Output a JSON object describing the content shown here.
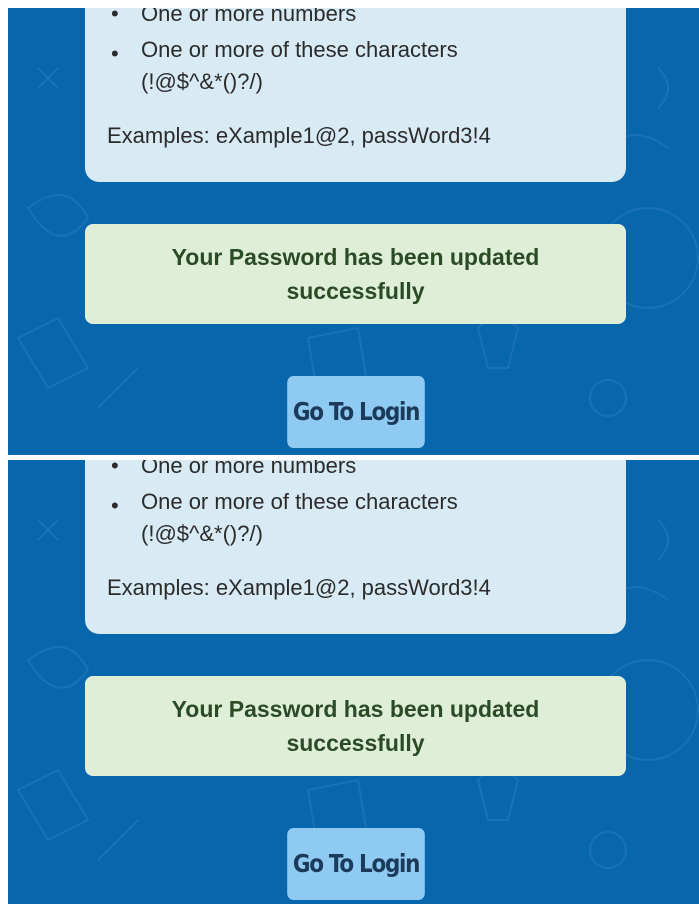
{
  "password_requirements": {
    "cut_off_item": "One or more numbers",
    "special_chars_item_line1": "One or more of these characters",
    "special_chars_item_line2": "(!@$^&*()?/)",
    "examples": "Examples: eXample1@2, passWord3!4"
  },
  "success_message": {
    "line1": "Your Password has been updated",
    "line2": "successfully"
  },
  "login_button": {
    "label": "Go To Login"
  },
  "colors": {
    "background": "#0866ad",
    "requirements_card": "#d8eaf4",
    "success_box": "#dfeed6",
    "success_text": "#2b4b27",
    "button": "#8fcaf3",
    "button_text": "#1c3a59"
  }
}
